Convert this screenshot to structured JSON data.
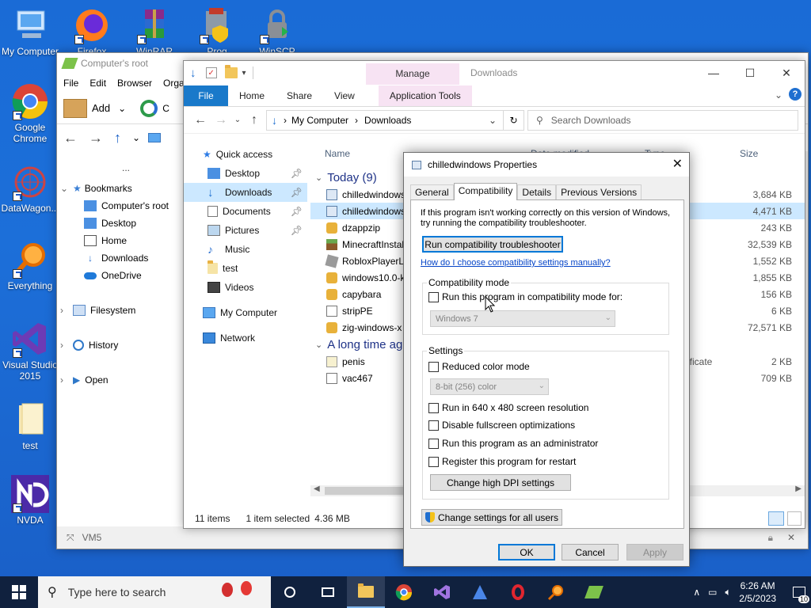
{
  "desktop": {
    "icons": [
      {
        "label": "My Computer"
      },
      {
        "label": "Firefox"
      },
      {
        "label": "WinRAR"
      },
      {
        "label": "Prog"
      },
      {
        "label": "WinSCP"
      },
      {
        "label": "Google Chrome"
      },
      {
        "label": "DataWagon..."
      },
      {
        "label": "Everything"
      },
      {
        "label": "Visual Studio 2015"
      },
      {
        "label": "test"
      },
      {
        "label": "NVDA"
      }
    ]
  },
  "back_window": {
    "title": "Computer's root",
    "menu": [
      "File",
      "Edit",
      "Browser",
      "Organ"
    ],
    "toolbar_add": "Add",
    "toolbar_c": "C",
    "tree": [
      "Bookmarks",
      "Computer's root",
      "Desktop",
      "Home",
      "Downloads",
      "OneDrive",
      "Filesystem",
      "History",
      "Open"
    ],
    "status": "VM5",
    "more": "..."
  },
  "explorer": {
    "title": "Downloads",
    "manage": "Manage",
    "tabs": [
      "File",
      "Home",
      "Share",
      "View",
      "Application Tools"
    ],
    "path": [
      "My Computer",
      "Downloads"
    ],
    "search_placeholder": "Search Downloads",
    "nav": [
      {
        "label": "Quick access"
      },
      {
        "label": "Desktop"
      },
      {
        "label": "Downloads"
      },
      {
        "label": "Documents"
      },
      {
        "label": "Pictures"
      },
      {
        "label": "Music"
      },
      {
        "label": "test"
      },
      {
        "label": "Videos"
      },
      {
        "label": "My Computer"
      },
      {
        "label": "Network"
      }
    ],
    "columns": [
      "Name",
      "Date modified",
      "Type",
      "Size"
    ],
    "groups": [
      "Today (9)",
      "A long time ag"
    ],
    "files": [
      {
        "name": "chilledwindows",
        "type": "",
        "size": "3,684 KB"
      },
      {
        "name": "chilledwindows",
        "type": "n",
        "size": "4,471 KB"
      },
      {
        "name": "dzappzip",
        "type": "",
        "size": "243 KB"
      },
      {
        "name": "MinecraftInstal",
        "type": "n",
        "size": "32,539 KB"
      },
      {
        "name": "RobloxPlayerLa",
        "type": "n",
        "size": "1,552 KB"
      },
      {
        "name": "windows10.0-k",
        "type": "e",
        "size": "1,855 KB"
      },
      {
        "name": "capybara",
        "type": "",
        "size": "156 KB"
      },
      {
        "name": "stripPE",
        "type": "",
        "size": "6 KB"
      },
      {
        "name": "zig-windows-x",
        "type": "",
        "size": "72,571 KB"
      },
      {
        "name": "penis",
        "type": "ertificate",
        "size": "2 KB"
      },
      {
        "name": "vac467",
        "type": "n",
        "size": "709 KB"
      }
    ],
    "status_items": "11 items",
    "status_selected": "1 item selected",
    "status_size": "4.36 MB"
  },
  "dialog": {
    "title": "chilledwindows Properties",
    "tabs": [
      "General",
      "Compatibility",
      "Details",
      "Previous Versions"
    ],
    "intro": "If this program isn't working correctly on this version of Windows, try running the compatibility troubleshooter.",
    "troubleshoot_btn": "Run compatibility troubleshooter",
    "help_link": "How do I choose compatibility settings manually?",
    "compat_group": "Compatibility mode",
    "compat_check": "Run this program in compatibility mode for:",
    "compat_os": "Windows 7",
    "settings_group": "Settings",
    "reduced_color": "Reduced color mode",
    "color_depth": "8-bit (256) color",
    "res640": "Run in 640 x 480 screen resolution",
    "disable_fs": "Disable fullscreen optimizations",
    "run_admin": "Run this program as an administrator",
    "register_restart": "Register this program for restart",
    "dpi_btn": "Change high DPI settings",
    "all_users_btn": "Change settings for all users",
    "ok": "OK",
    "cancel": "Cancel",
    "apply": "Apply"
  },
  "taskbar": {
    "search_placeholder": "Type here to search",
    "time": "6:26 AM",
    "date": "2/5/2023",
    "notifications": "10"
  }
}
